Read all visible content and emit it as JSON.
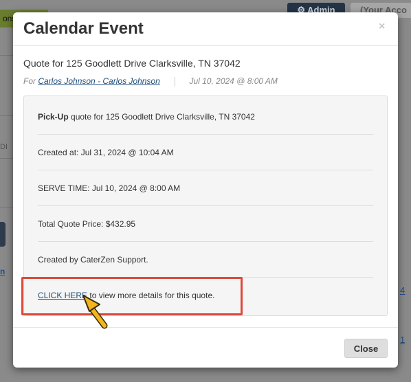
{
  "background": {
    "green_label": "ons",
    "admin_label": "⚙ Admin",
    "account_label": "(Your Acco",
    "left_link": "n",
    "left_text": "DI",
    "row_link_4": "4",
    "row_link_1": "1"
  },
  "modal": {
    "title": "Calendar Event",
    "close_icon": "×",
    "subject": "Quote for 125 Goodlett Drive Clarksville, TN 37042",
    "for_label": "For",
    "client_link": "Carlos Johnson - Carlos Johnson",
    "datetime": "Jul 10, 2024 @ 8:00 AM",
    "details": {
      "pickup_bold": "Pick-Up",
      "pickup_rest": " quote for 125 Goodlett Drive Clarksville, TN 37042",
      "created_at": "Created at: Jul 31, 2024 @ 10:04 AM",
      "serve_time": "SERVE TIME: Jul 10, 2024 @ 8:00 AM",
      "total_price": "Total Quote Price: $432.95",
      "created_by": "Created by CaterZen Support.",
      "click_here": "CLICK HERE",
      "click_here_rest": " to view more details for this quote."
    },
    "footer": {
      "close_label": "Close"
    }
  },
  "annotation": {
    "highlight_color": "#dc4a3b",
    "arrow_color": "#f2b51d",
    "arrow_icon": "arrow-pointer-icon"
  },
  "colors": {
    "link": "#1f4e79",
    "well_bg": "#f5f5f5",
    "overlay": "#8a8a8a"
  }
}
